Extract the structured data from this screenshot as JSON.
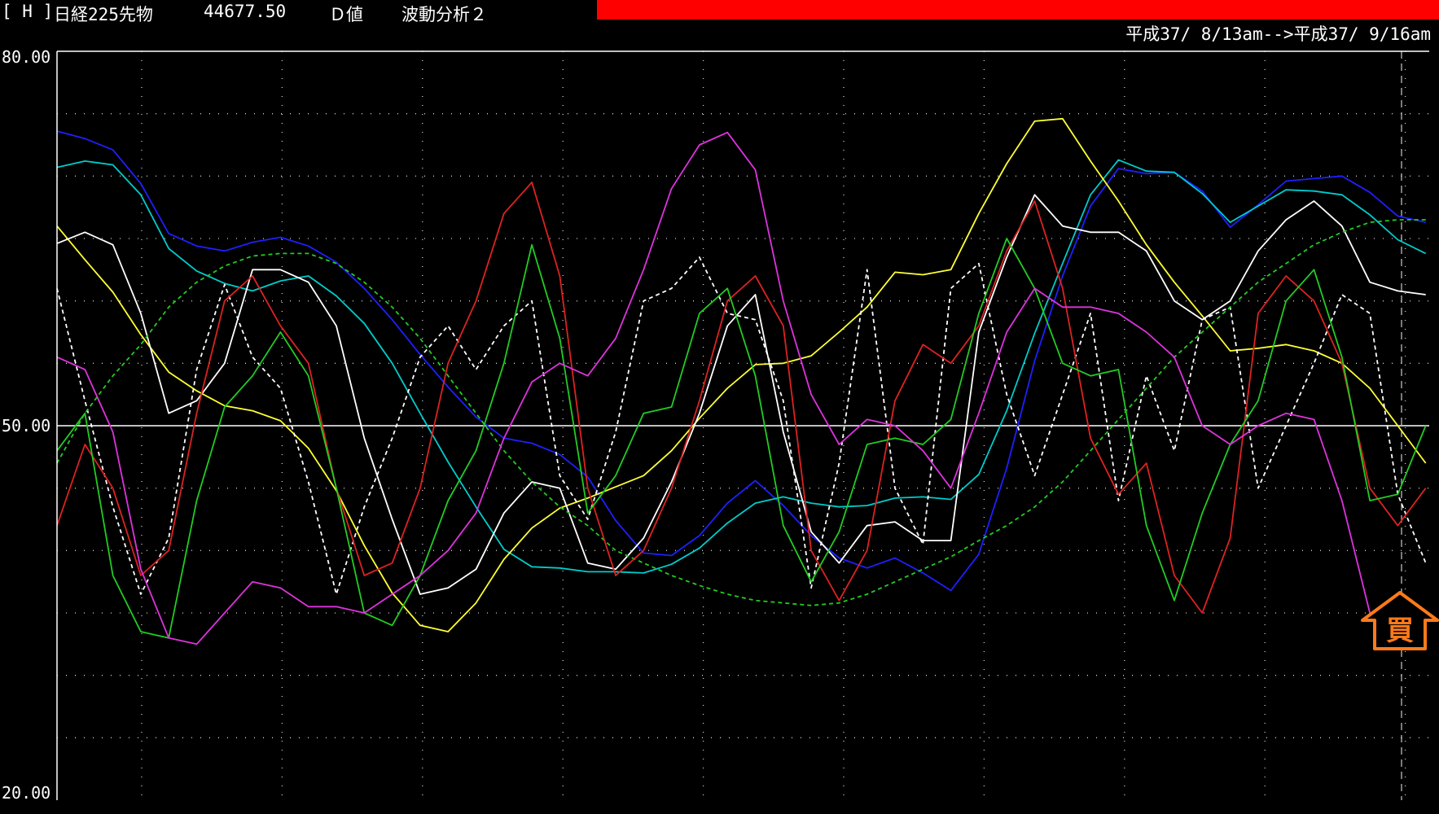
{
  "header": {
    "code": "[ H ]",
    "instrument": "日経225先物",
    "price": "44677.50",
    "mode": "Ｄ値",
    "analysis": "波動分析２",
    "range": "平成37/ 8/13am-->平成37/ 9/16am"
  },
  "colors": {
    "background": "#000000",
    "bar": "#ff0000",
    "grid": "#cfcfcf",
    "arrow": "#ff7a1a"
  },
  "signal": {
    "label": "買",
    "icon": "up-arrow-icon"
  },
  "chart_data": {
    "type": "line",
    "ylim": [
      20,
      80
    ],
    "yticks": [
      "80.00",
      "50.00",
      "20.00"
    ],
    "midline": 50,
    "n": 50,
    "series": [
      {
        "color": "#1f1fff",
        "style": "solid",
        "values": [
          73.6,
          73.0,
          72.1,
          69.4,
          65.4,
          64.4,
          64.0,
          64.7,
          65.1,
          64.4,
          63.1,
          61.0,
          58.5,
          55.7,
          53.1,
          50.7,
          49.0,
          48.6,
          47.7,
          45.9,
          42.4,
          39.8,
          39.6,
          41.2,
          43.8,
          45.6,
          43.6,
          41.2,
          39.4,
          38.6,
          39.4,
          38.2,
          36.8,
          39.7,
          46.6,
          55.2,
          62.0,
          67.6,
          70.6,
          70.2,
          70.3,
          68.8,
          65.9,
          67.7,
          69.6,
          69.8,
          70.0,
          68.7,
          66.8,
          66.3
        ]
      },
      {
        "color": "#00cccc",
        "style": "solid",
        "values": [
          70.7,
          71.2,
          70.9,
          68.5,
          64.2,
          62.4,
          61.4,
          60.8,
          61.6,
          62.0,
          60.4,
          58.2,
          55.0,
          51.0,
          47.1,
          43.5,
          40.1,
          38.7,
          38.6,
          38.3,
          38.3,
          38.2,
          38.9,
          40.2,
          42.2,
          43.8,
          44.3,
          43.8,
          43.5,
          43.6,
          44.2,
          44.3,
          44.1,
          46.1,
          51.2,
          57.4,
          63.0,
          68.5,
          71.3,
          70.4,
          70.3,
          68.6,
          66.3,
          67.6,
          68.9,
          68.8,
          68.5,
          66.9,
          64.9,
          63.8
        ]
      },
      {
        "color": "#ffff33",
        "style": "solid",
        "values": [
          66.0,
          63.3,
          60.7,
          57.3,
          54.3,
          52.8,
          51.6,
          51.2,
          50.4,
          48.2,
          44.8,
          40.4,
          36.6,
          34.0,
          33.5,
          35.8,
          39.3,
          41.8,
          43.4,
          44.2,
          45.1,
          46.0,
          48.0,
          50.6,
          53.0,
          54.9,
          55.0,
          55.6,
          57.5,
          59.5,
          62.3,
          62.1,
          62.5,
          67.0,
          71.0,
          74.4,
          74.6,
          71.2,
          68.0,
          64.5,
          61.5,
          58.8,
          56.0,
          56.2,
          56.5,
          56.0,
          55.0,
          53.0,
          50.0,
          47.0
        ]
      },
      {
        "color": "#ffffff",
        "style": "solid",
        "values": [
          64.6,
          65.5,
          64.5,
          59.0,
          51.0,
          52.0,
          55.0,
          62.5,
          62.5,
          61.5,
          58.0,
          49.0,
          42.5,
          36.5,
          37.0,
          38.5,
          43.0,
          45.5,
          45.0,
          39.0,
          38.5,
          41.0,
          45.5,
          51.0,
          58.0,
          60.5,
          49.5,
          41.5,
          39.0,
          42.0,
          42.3,
          40.8,
          40.8,
          57.5,
          63.5,
          68.5,
          66.0,
          65.5,
          65.5,
          64.0,
          60.0,
          58.5,
          60.0,
          64.0,
          66.5,
          68.0,
          66.0,
          61.5,
          60.8,
          60.5
        ]
      },
      {
        "color": "#ffffff",
        "style": "dashed",
        "values": [
          61.0,
          52.0,
          43.5,
          36.5,
          41.0,
          54.5,
          61.3,
          55.5,
          53.0,
          45.5,
          36.5,
          43.5,
          49.0,
          55.5,
          58.0,
          54.5,
          58.0,
          60.0,
          46.0,
          42.5,
          49.5,
          60.0,
          61.0,
          63.5,
          59.0,
          58.5,
          52.0,
          37.0,
          47.0,
          62.5,
          45.0,
          40.5,
          61.0,
          63.0,
          52.5,
          46.0,
          52.5,
          59.0,
          44.0,
          54.0,
          48.0,
          58.5,
          59.5,
          45.0,
          50.0,
          55.0,
          60.5,
          59.0,
          44.5,
          39.0
        ]
      },
      {
        "color": "#22cc22",
        "style": "dashed",
        "values": [
          47.0,
          51.0,
          54.0,
          56.5,
          59.5,
          61.5,
          62.8,
          63.6,
          63.8,
          63.8,
          63.0,
          61.5,
          59.5,
          57.0,
          54.0,
          51.0,
          48.0,
          45.5,
          43.5,
          42.0,
          40.0,
          39.0,
          38.0,
          37.2,
          36.5,
          36.0,
          35.8,
          35.6,
          35.8,
          36.5,
          37.5,
          38.5,
          39.5,
          40.8,
          42.0,
          43.5,
          45.5,
          48.0,
          50.5,
          53.0,
          55.5,
          57.5,
          59.5,
          61.5,
          63.0,
          64.5,
          65.5,
          66.3,
          66.5,
          66.5
        ]
      },
      {
        "color": "#dd2222",
        "style": "solid",
        "values": [
          42.0,
          48.5,
          45.0,
          38.0,
          40.0,
          51.0,
          60.0,
          62.0,
          58.0,
          55.0,
          45.0,
          38.0,
          39.0,
          45.0,
          55.0,
          60.0,
          67.0,
          69.5,
          62.0,
          45.0,
          38.0,
          40.0,
          45.0,
          52.0,
          60.0,
          62.0,
          58.0,
          40.0,
          36.0,
          40.0,
          52.0,
          56.5,
          55.0,
          58.0,
          64.0,
          68.0,
          61.0,
          49.0,
          44.5,
          47.0,
          38.0,
          35.0,
          41.0,
          59.0,
          62.0,
          60.0,
          55.0,
          45.0,
          42.0,
          45.0
        ]
      },
      {
        "color": "#22cc22",
        "style": "solid",
        "values": [
          48.0,
          51.0,
          38.0,
          33.5,
          33.0,
          44.0,
          51.5,
          54.0,
          57.5,
          54.0,
          45.0,
          35.0,
          34.0,
          38.0,
          44.0,
          48.0,
          55.0,
          64.5,
          57.0,
          43.0,
          46.0,
          51.0,
          51.5,
          59.0,
          61.0,
          54.0,
          42.0,
          37.5,
          41.5,
          48.5,
          49.0,
          48.5,
          50.5,
          59.0,
          65.0,
          61.0,
          55.0,
          54.0,
          54.5,
          42.0,
          36.0,
          43.0,
          48.5,
          52.0,
          60.0,
          62.5,
          55.5,
          44.0,
          44.5,
          50.0
        ]
      },
      {
        "color": "#dd33dd",
        "style": "solid",
        "values": [
          55.5,
          54.5,
          49.5,
          38.5,
          33.0,
          32.5,
          35.0,
          37.5,
          37.0,
          35.5,
          35.5,
          35.0,
          36.5,
          38.0,
          40.0,
          43.0,
          49.0,
          53.5,
          55.0,
          54.0,
          57.0,
          62.5,
          69.0,
          72.5,
          73.5,
          70.5,
          60.0,
          52.5,
          48.5,
          50.5,
          50.0,
          48.0,
          45.0,
          51.0,
          57.5,
          61.0,
          59.5,
          59.5,
          59.0,
          57.5,
          55.5,
          50.0,
          48.5,
          50.0,
          51.0,
          50.5,
          44.0,
          35.0,
          34.0,
          33.0
        ]
      }
    ]
  }
}
